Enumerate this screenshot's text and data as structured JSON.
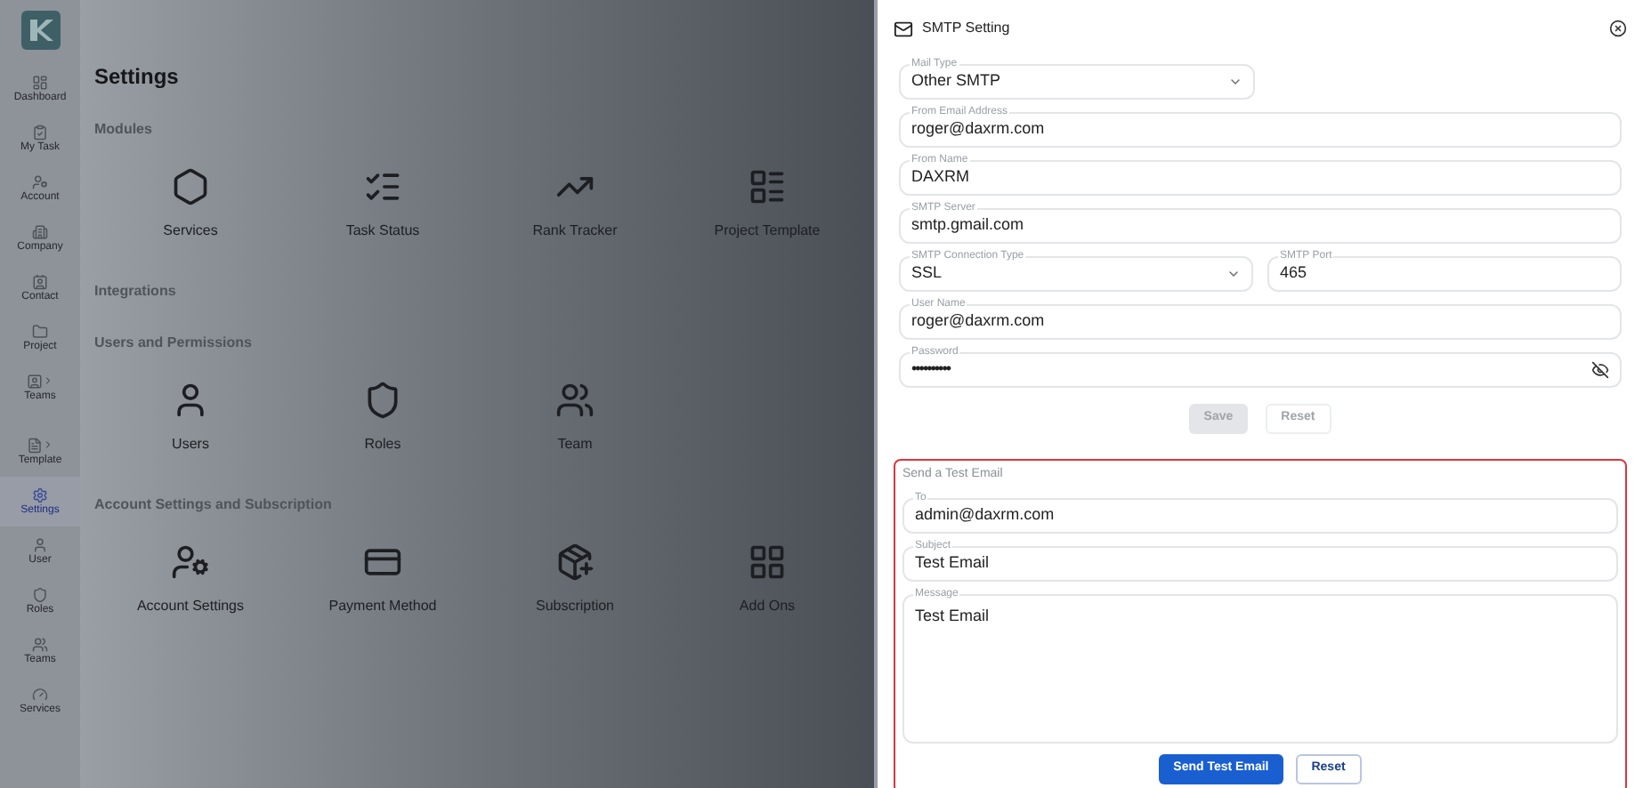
{
  "sidebar": {
    "items": [
      {
        "label": "Dashboard",
        "kind": "dashboard",
        "selected": false,
        "submenu": false
      },
      {
        "label": "My Task",
        "kind": "task",
        "selected": false,
        "submenu": false
      },
      {
        "label": "Account",
        "kind": "account",
        "selected": false,
        "submenu": false
      },
      {
        "label": "Company",
        "kind": "company",
        "selected": false,
        "submenu": false
      },
      {
        "label": "Contact",
        "kind": "contact",
        "selected": false,
        "submenu": false
      },
      {
        "label": "Project",
        "kind": "project",
        "selected": false,
        "submenu": false
      },
      {
        "label": "Teams",
        "kind": "teams",
        "selected": false,
        "submenu": true
      },
      {
        "label": "Template",
        "kind": "template",
        "selected": false,
        "submenu": true
      },
      {
        "label": "Settings",
        "kind": "settings",
        "selected": true,
        "submenu": false
      },
      {
        "label": "User",
        "kind": "user",
        "selected": false,
        "submenu": false
      },
      {
        "label": "Roles",
        "kind": "roles",
        "selected": false,
        "submenu": false
      },
      {
        "label": "Teams",
        "kind": "team",
        "selected": false,
        "submenu": false
      },
      {
        "label": "Services",
        "kind": "services",
        "selected": false,
        "submenu": false
      }
    ]
  },
  "page": {
    "title": "Settings",
    "sections": [
      {
        "title": "Modules",
        "items": [
          {
            "label": "Services",
            "kind": "services"
          },
          {
            "label": "Task Status",
            "kind": "task_status"
          },
          {
            "label": "Rank Tracker",
            "kind": "rank"
          },
          {
            "label": "Project Template",
            "kind": "template"
          }
        ]
      },
      {
        "title": "Integrations"
      },
      {
        "title": "Users and Permissions",
        "items": [
          {
            "label": "Users",
            "kind": "user"
          },
          {
            "label": "Roles",
            "kind": "roles"
          },
          {
            "label": "Team",
            "kind": "team"
          }
        ]
      },
      {
        "title": "Account Settings and Subscription",
        "items": [
          {
            "label": "Account Settings",
            "kind": "account"
          },
          {
            "label": "Payment Method",
            "kind": "payment"
          },
          {
            "label": "Subscription",
            "kind": "subscription"
          },
          {
            "label": "Add Ons",
            "kind": "addons"
          }
        ]
      }
    ]
  },
  "panel": {
    "title": "SMTP Setting",
    "rows": [
      [
        {
          "label": "Mail Type",
          "value": "Other SMTP",
          "kind": "select"
        }
      ],
      [
        {
          "label": "From Email Address",
          "value": "roger@daxrm.com",
          "kind": "text"
        }
      ],
      [
        {
          "label": "From Name",
          "value": "DAXRM",
          "kind": "text"
        }
      ],
      [
        {
          "label": "SMTP Server",
          "value": "smtp.gmail.com",
          "kind": "text"
        }
      ],
      [
        {
          "label": "SMTP Connection Type",
          "value": "SSL",
          "kind": "select"
        },
        {
          "label": "SMTP Port",
          "value": "465",
          "kind": "text"
        }
      ],
      [
        {
          "label": "User Name",
          "value": "roger@daxrm.com",
          "kind": "text"
        }
      ],
      [
        {
          "label": "Password",
          "value": "••••••••••",
          "kind": "password"
        }
      ]
    ],
    "buttons": [
      {
        "label": "Save",
        "kind": "primary",
        "disabled": true
      },
      {
        "label": "Reset",
        "kind": "secondary",
        "disabled": true
      }
    ],
    "test": {
      "title": "Send a Test Email",
      "fields": [
        {
          "label": "To",
          "value": "admin@daxrm.com",
          "kind": "text"
        },
        {
          "label": "Subject",
          "value": "Test Email",
          "kind": "text"
        },
        {
          "label": "Message",
          "value": "Test Email",
          "kind": "textarea"
        }
      ],
      "buttons": [
        {
          "label": "Send Test Email",
          "kind": "primary",
          "disabled": false
        },
        {
          "label": "Reset",
          "kind": "secondary",
          "disabled": false
        }
      ]
    }
  }
}
